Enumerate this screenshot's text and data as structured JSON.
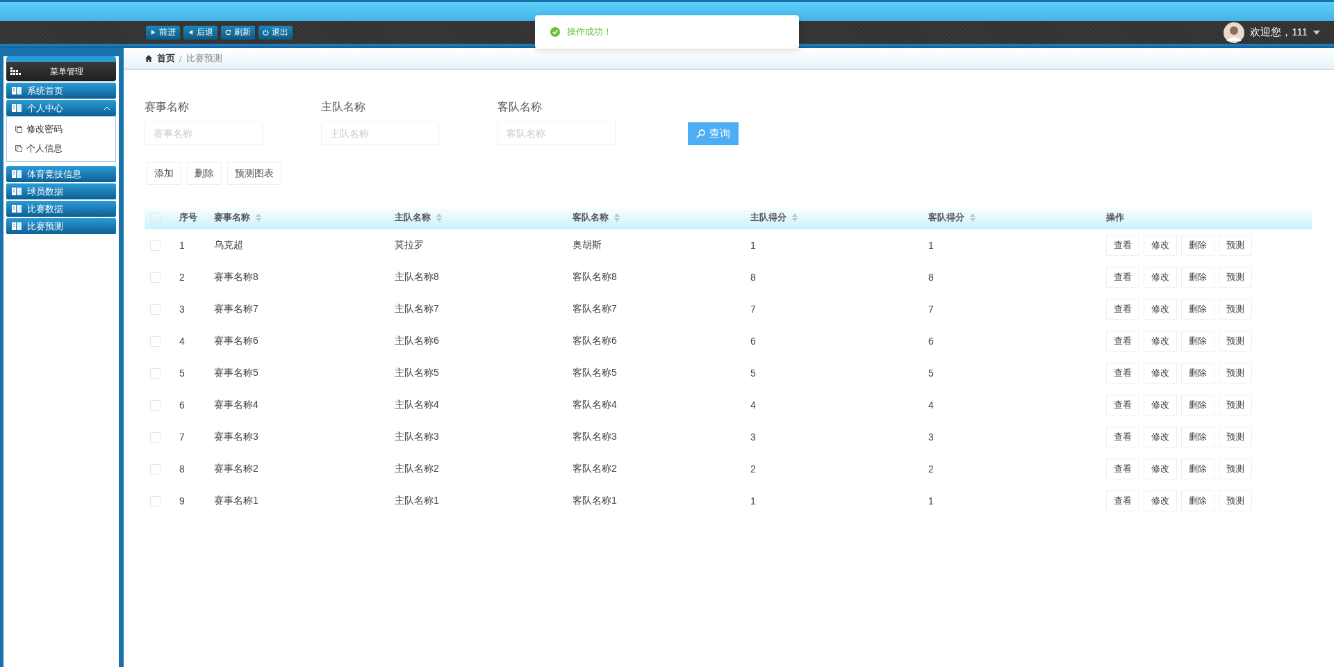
{
  "toolbar": {
    "buttons": [
      {
        "label": "前进",
        "kind": "forward"
      },
      {
        "label": "后退",
        "kind": "back"
      },
      {
        "label": "刷新",
        "kind": "refresh"
      },
      {
        "label": "退出",
        "kind": "logout"
      }
    ]
  },
  "toast": {
    "message": "操作成功！"
  },
  "user": {
    "greeting": "欢迎您，111"
  },
  "sidebar": {
    "title": "菜单管理",
    "items": [
      {
        "label": "系统首页"
      },
      {
        "label": "个人中心",
        "expanded": true,
        "children": [
          {
            "label": "修改密码"
          },
          {
            "label": "个人信息"
          }
        ]
      },
      {
        "label": "体育竞技信息"
      },
      {
        "label": "球员数据"
      },
      {
        "label": "比赛数据"
      },
      {
        "label": "比赛预测"
      }
    ]
  },
  "breadcrumb": {
    "home": "首页",
    "separator": "/",
    "current": "比赛预测"
  },
  "filters": [
    {
      "label": "赛事名称",
      "placeholder": "赛事名称"
    },
    {
      "label": "主队名称",
      "placeholder": "主队名称"
    },
    {
      "label": "客队名称",
      "placeholder": "客队名称"
    }
  ],
  "search_button": "查询",
  "actions": [
    "添加",
    "删除",
    "预测图表"
  ],
  "table": {
    "header_checked": false,
    "columns": [
      {
        "label": "序号",
        "sortable": false
      },
      {
        "label": "赛事名称",
        "sortable": true
      },
      {
        "label": "主队名称",
        "sortable": true
      },
      {
        "label": "客队名称",
        "sortable": true
      },
      {
        "label": "主队得分",
        "sortable": true
      },
      {
        "label": "客队得分",
        "sortable": true
      },
      {
        "label": "操作",
        "sortable": false
      }
    ],
    "rows": [
      {
        "checked": false,
        "cells": [
          "1",
          "乌克超",
          "莫拉罗",
          "奥胡斯",
          "1",
          "1"
        ],
        "buttons": [
          "查看",
          "修改",
          "删除",
          "预测"
        ]
      },
      {
        "checked": false,
        "cells": [
          "2",
          "赛事名称8",
          "主队名称8",
          "客队名称8",
          "8",
          "8"
        ],
        "buttons": [
          "查看",
          "修改",
          "删除",
          "预测"
        ]
      },
      {
        "checked": false,
        "cells": [
          "3",
          "赛事名称7",
          "主队名称7",
          "客队名称7",
          "7",
          "7"
        ],
        "buttons": [
          "查看",
          "修改",
          "删除",
          "预测"
        ]
      },
      {
        "checked": false,
        "cells": [
          "4",
          "赛事名称6",
          "主队名称6",
          "客队名称6",
          "6",
          "6"
        ],
        "buttons": [
          "查看",
          "修改",
          "删除",
          "预测"
        ]
      },
      {
        "checked": false,
        "cells": [
          "5",
          "赛事名称5",
          "主队名称5",
          "客队名称5",
          "5",
          "5"
        ],
        "buttons": [
          "查看",
          "修改",
          "删除",
          "预测"
        ]
      },
      {
        "checked": false,
        "cells": [
          "6",
          "赛事名称4",
          "主队名称4",
          "客队名称4",
          "4",
          "4"
        ],
        "buttons": [
          "查看",
          "修改",
          "删除",
          "预测"
        ]
      },
      {
        "checked": false,
        "cells": [
          "7",
          "赛事名称3",
          "主队名称3",
          "客队名称3",
          "3",
          "3"
        ],
        "buttons": [
          "查看",
          "修改",
          "删除",
          "预测"
        ]
      },
      {
        "checked": false,
        "cells": [
          "8",
          "赛事名称2",
          "主队名称2",
          "客队名称2",
          "2",
          "2"
        ],
        "buttons": [
          "查看",
          "修改",
          "删除",
          "预测"
        ]
      },
      {
        "checked": false,
        "cells": [
          "9",
          "赛事名称1",
          "主队名称1",
          "客队名称1",
          "1",
          "1"
        ],
        "buttons": [
          "查看",
          "修改",
          "删除",
          "预测"
        ]
      }
    ]
  }
}
